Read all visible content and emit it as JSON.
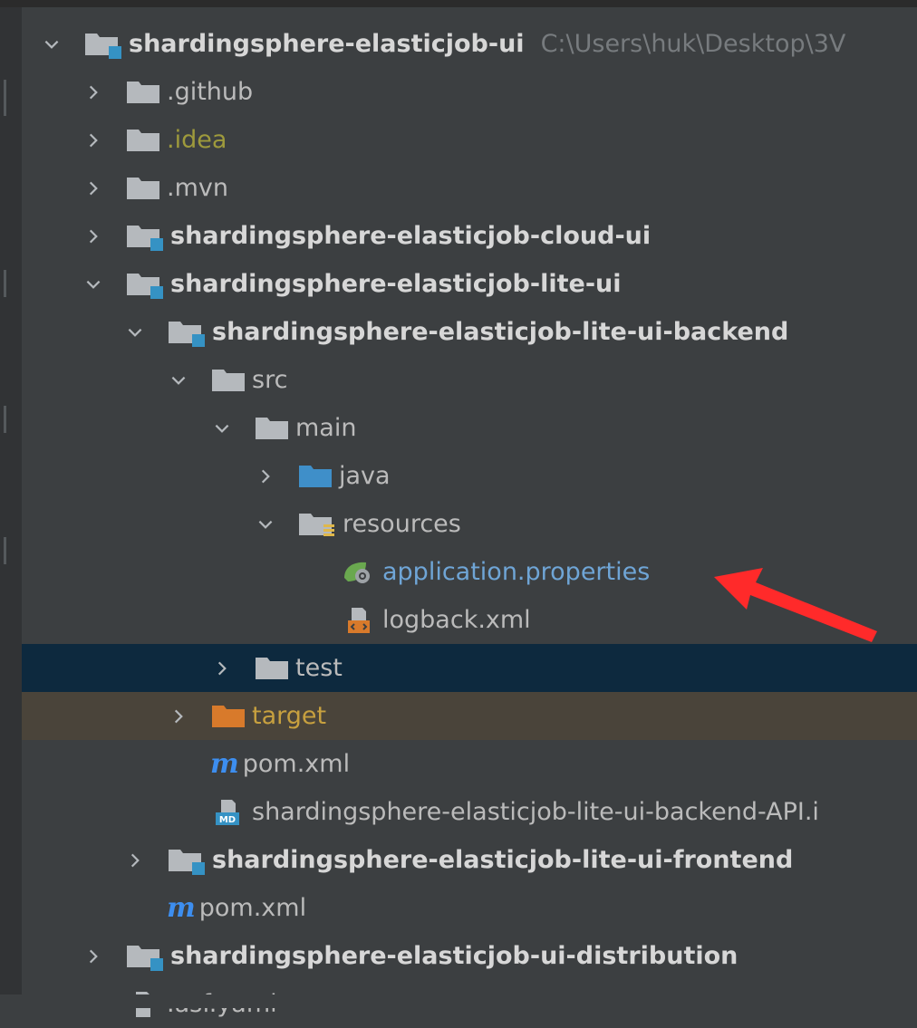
{
  "colors": {
    "background": "#3c3f41",
    "selected_row": "#0d293e",
    "excluded_row": "#4a443a",
    "annotation_arrow": "#ff2a2a"
  },
  "tree": {
    "root": {
      "label": "shardingsphere-elasticjob-ui",
      "path": "C:\\Users\\huk\\Desktop\\3V"
    },
    "nodes": {
      "github": ".github",
      "idea": ".idea",
      "mvn": ".mvn",
      "cloud_ui": "shardingsphere-elasticjob-cloud-ui",
      "lite_ui": "shardingsphere-elasticjob-lite-ui",
      "backend": "shardingsphere-elasticjob-lite-ui-backend",
      "src": "src",
      "main": "main",
      "java": "java",
      "resources": "resources",
      "app_props": "application.properties",
      "logback": "logback.xml",
      "test": "test",
      "target": "target",
      "backend_pom": "pom.xml",
      "api_md": "shardingsphere-elasticjob-lite-ui-backend-API.i",
      "frontend": "shardingsphere-elasticjob-lite-ui-frontend",
      "lite_pom": "pom.xml",
      "distribution": "shardingsphere-elasticjob-ui-distribution",
      "asf": ".asf.yaml"
    },
    "icons": {
      "module_folder": "module-folder-icon",
      "folder": "folder-icon",
      "source_folder": "source-folder-icon",
      "resources_folder": "resources-folder-icon",
      "excluded_folder": "excluded-folder-icon",
      "spring_properties": "spring-properties-icon",
      "xml": "xml-file-icon",
      "maven": "maven-icon",
      "markdown": "markdown-file-icon"
    }
  }
}
